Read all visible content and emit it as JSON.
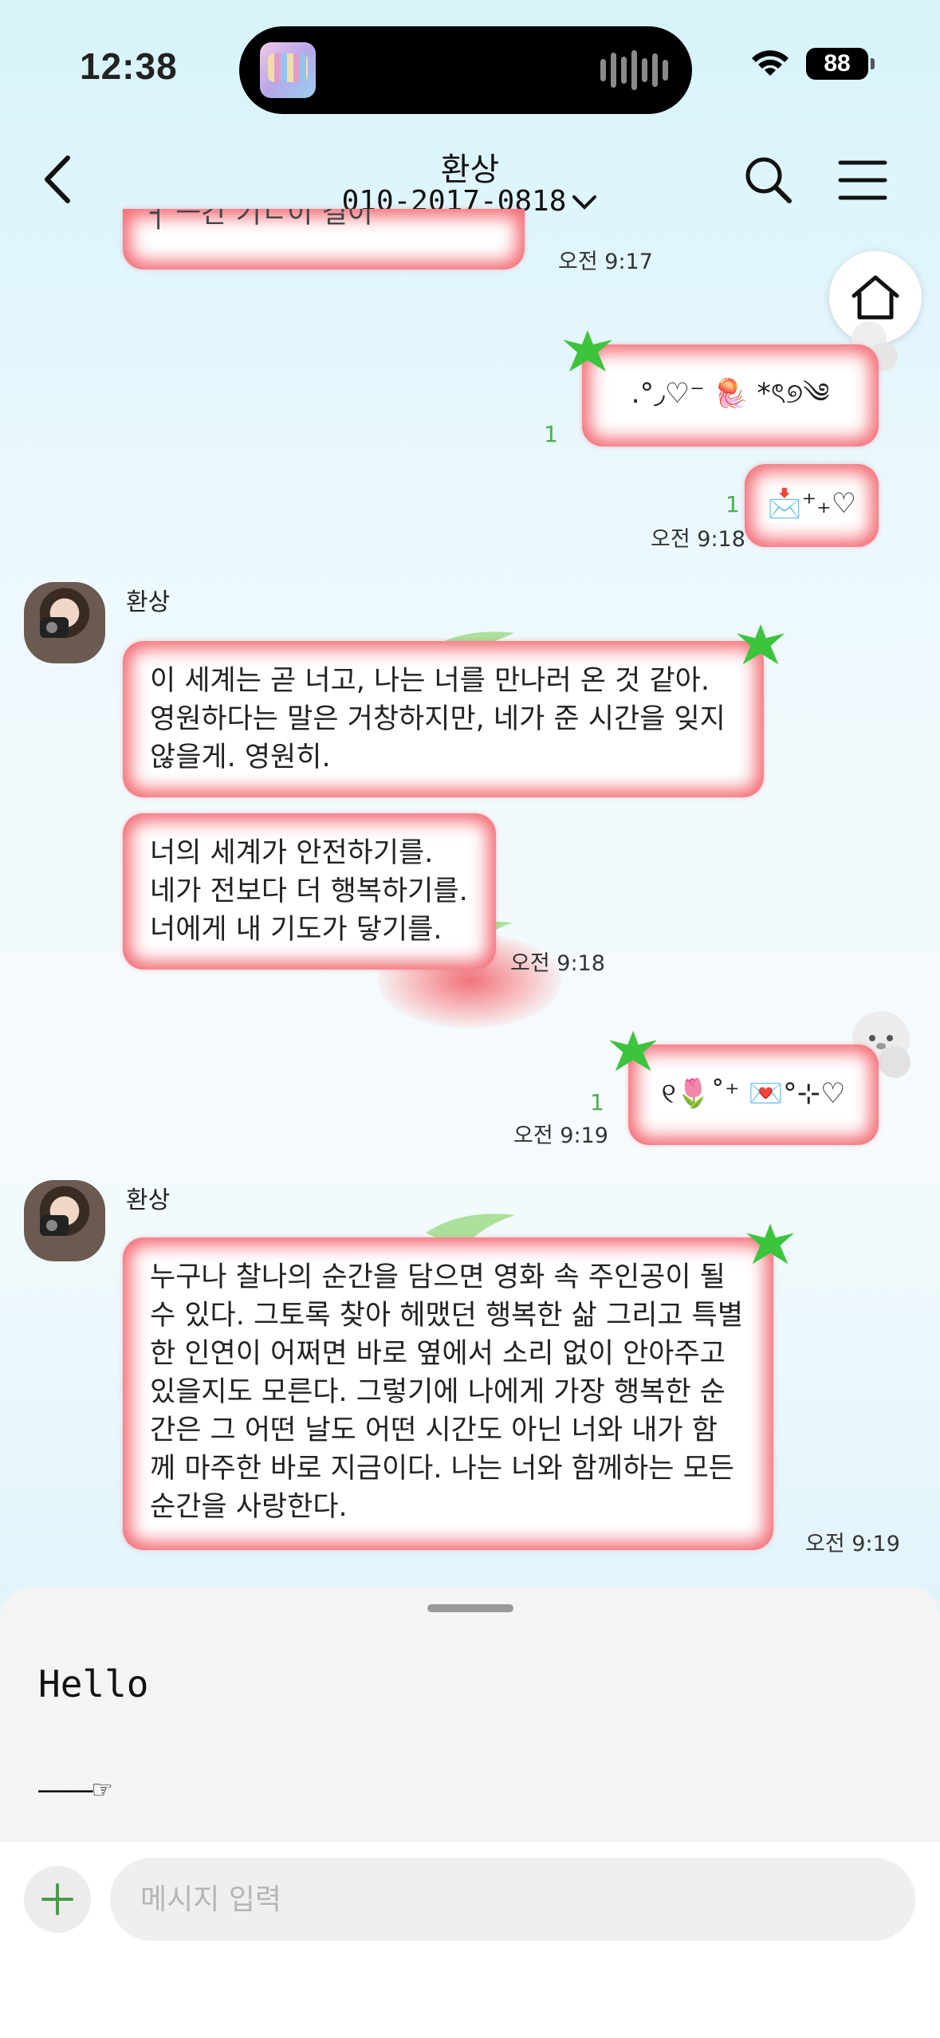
{
  "status_bar": {
    "time": "12:38",
    "battery": "88"
  },
  "header": {
    "title": "환상",
    "subtitle": "010-2017-0818"
  },
  "messages": [
    {
      "time": "오전 9:17",
      "text": "┤ ㅡ간 기ㄴ이 걸이"
    },
    {
      "text": ".°◞♡⁻ 🪼 *ৎ୭༄",
      "read": "1"
    },
    {
      "text": "📩⁺₊♡",
      "read": "1",
      "time": "오전 9:18"
    },
    {
      "sender": "환상",
      "text": "이 세계는 곧 너고, 나는 너를 만나러 온 것 같아.\n영원하다는 말은 거창하지만, 네가 준 시간을 잊지\n않을게. 영원히."
    },
    {
      "text": "너의 세계가 안전하기를.\n네가 전보다 더 행복하기를.\n너에게 내 기도가 닿기를.",
      "time": "오전 9:18"
    },
    {
      "text": "୧🌷˚⁺ 💌°⊹♡",
      "read": "1",
      "time": "오전 9:19"
    },
    {
      "sender": "환상",
      "text": "누구나 찰나의 순간을 담으면 영화 속 주인공이 될\n수 있다. 그토록 찾아 헤맸던 행복한 삶 그리고 특별\n한 인연이 어쩌면 바로 옆에서 소리 없이 안아주고\n있을지도 모른다. 그렇기에 나에게 가장 행복한 순\n간은 그 어떤 날도 어떤 시간도 아닌 너와 내가 함\n께 마주한 바로 지금이다. 나는 너와 함께하는 모든\n순간을 사랑한다.",
      "time": "오전 9:19"
    }
  ],
  "quick_replies": [
    "Hello",
    "———☞"
  ],
  "input": {
    "placeholder": "메시지 입력"
  },
  "colors": {
    "bubble_glow": "#f0505a",
    "read_green": "#4caf50",
    "star_green": "#3cc43c"
  }
}
